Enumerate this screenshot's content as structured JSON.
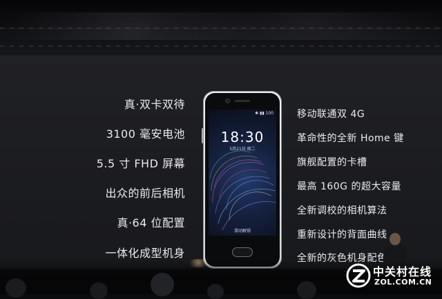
{
  "left_features": [
    "真·双卡双待",
    "3100 毫安电池",
    "5.5 寸 FHD 屏幕",
    "出众的前后相机",
    "真·64 位配置",
    "一体化成型机身"
  ],
  "right_features": [
    "移动联通双 4G",
    "革命性的全新 Home 键",
    "旗舰配置的卡槽",
    "最高 160G 的超大容量",
    "全新调校的相机算法",
    "重新设计的背面曲线",
    "全新的灰色机身配色"
  ],
  "phone": {
    "status": "✱ ▮▮ 100",
    "time": "18:30",
    "date": "5月21日 周二",
    "unlock_hint": "滑动解锁"
  },
  "watermark": {
    "name": "中关村在线",
    "url": "ZOL.COM.CN"
  },
  "colors": {
    "screen": "#1d1e21",
    "text": "#e9ebee",
    "phone_body": "#e6e8ea"
  }
}
